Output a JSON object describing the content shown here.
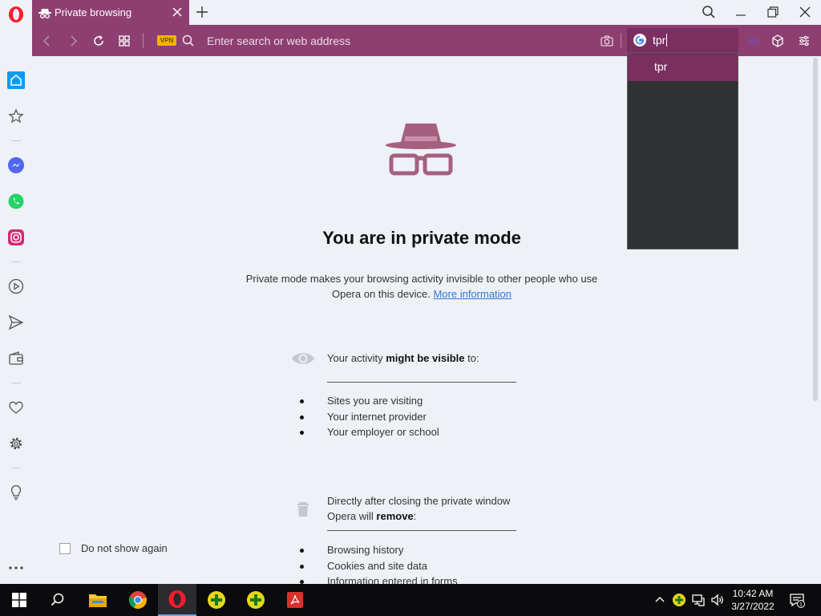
{
  "window": {
    "tab_title": "Private browsing"
  },
  "address_bar": {
    "placeholder": "Enter search or web address",
    "vpn_label": "VPN"
  },
  "search_popup": {
    "query": "tpr",
    "suggestions": [
      "tpr"
    ]
  },
  "sidebar": {
    "items": [
      "home",
      "bookmarks",
      "messenger",
      "whatsapp",
      "instagram",
      "player",
      "send",
      "wallet",
      "favorites",
      "settings",
      "tips",
      "more"
    ]
  },
  "private_page": {
    "title": "You are in private mode",
    "description": "Private mode makes your browsing activity invisible to other people who use Opera on this device.",
    "more_link": "More information",
    "visible_section": {
      "prefix": "Your activity ",
      "bold": "might be visible",
      "suffix": " to:",
      "items": [
        "Sites you are visiting",
        "Your internet provider",
        "Your employer or school"
      ]
    },
    "remove_section": {
      "line1": "Directly after closing the private window",
      "line2_prefix": "Opera will ",
      "line2_bold": "remove",
      "line2_suffix": ":",
      "items": [
        "Browsing history",
        "Cookies and site data",
        "Information entered in forms"
      ]
    },
    "dont_show_label": "Do not show again"
  },
  "colors": {
    "opera_accent": "#8e3f72",
    "dropdown_bg": "#303132",
    "link": "#2e78d2"
  },
  "taskbar": {
    "time": "10:42 AM",
    "date": "3/27/2022",
    "notification_count": "1"
  }
}
